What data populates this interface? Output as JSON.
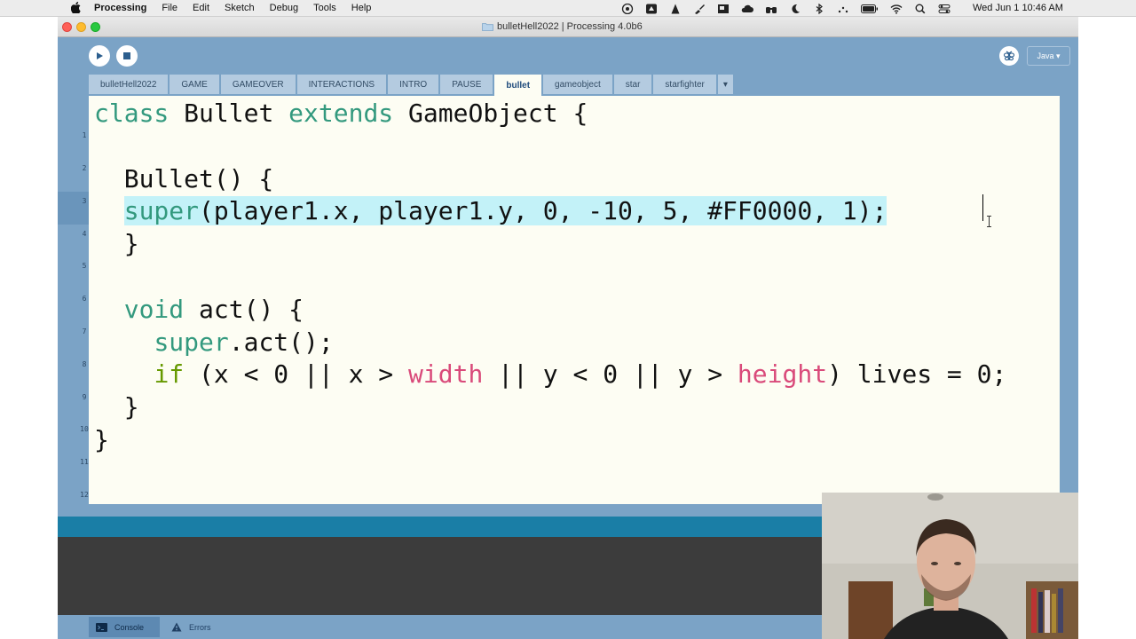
{
  "menubar": {
    "app_name": "Processing",
    "items": [
      "File",
      "Edit",
      "Sketch",
      "Debug",
      "Tools",
      "Help"
    ],
    "clock": "Wed Jun 1  10:46 AM"
  },
  "window": {
    "title": "bulletHell2022 | Processing 4.0b6"
  },
  "toolbar": {
    "mode_label": "Java ▾"
  },
  "tabs": [
    {
      "label": "bulletHell2022"
    },
    {
      "label": "GAME"
    },
    {
      "label": "GAMEOVER"
    },
    {
      "label": "INTERACTIONS"
    },
    {
      "label": "INTRO"
    },
    {
      "label": "PAUSE"
    },
    {
      "label": "bullet",
      "active": true
    },
    {
      "label": "gameobject"
    },
    {
      "label": "star"
    },
    {
      "label": "starfighter"
    }
  ],
  "tab_more": "▾",
  "editor": {
    "line_numbers": [
      "1",
      "2",
      "3",
      "4",
      "5",
      "6",
      "7",
      "8",
      "9",
      "10",
      "11",
      "12"
    ],
    "current_line": 4,
    "lines": [
      "class Bullet extends GameObject {",
      "",
      "  Bullet() {",
      "    super(player1.x, player1.y, 0, -10, 5, #FF0000, 1);",
      "  }",
      "",
      "  void act() {",
      "    super.act();",
      "    if (x < 0 || x > width || y < 0 || y > height) lives = 0;",
      "  }",
      "}",
      ""
    ],
    "tokens": {
      "l1": {
        "k1": "class",
        "t1": " Bullet ",
        "k2": "extends",
        "t2": " GameObject {"
      },
      "l3": {
        "t1": "  Bullet() {"
      },
      "l4": {
        "indent": "  ",
        "k1": "super",
        "t1": "(player1.x, player1.y, 0, -10, 5, #FF0000, 1);"
      },
      "l5": {
        "t1": "  }"
      },
      "l7": {
        "i": "  ",
        "k1": "void",
        "t1": " act() {"
      },
      "l8": {
        "i": "    ",
        "k1": "super",
        "t1": ".act();"
      },
      "l9": {
        "i": "    ",
        "k1": "if",
        "t1": " (x < 0 || x > ",
        "s1": "width",
        "t2": " || y < 0 || y > ",
        "s2": "height",
        "t3": ") lives = 0;"
      },
      "l10": {
        "t1": "  }"
      },
      "l11": {
        "t1": "}"
      }
    }
  },
  "footer": {
    "console_label": "Console",
    "errors_label": "Errors"
  },
  "icons": {
    "run": "play-icon",
    "stop": "stop-icon",
    "debug": "butterfly-icon",
    "console": "terminal-icon",
    "errors": "warning-icon"
  },
  "colors": {
    "chrome": "#7ba3c6",
    "editor_bg": "#fdfdf3",
    "keyword": "#33997e",
    "keyword_control": "#669900",
    "builtin": "#d94a7a",
    "selection": "#c3f2f8",
    "status_bar": "#1a7ea6",
    "console_bg": "#3c3c3c"
  }
}
